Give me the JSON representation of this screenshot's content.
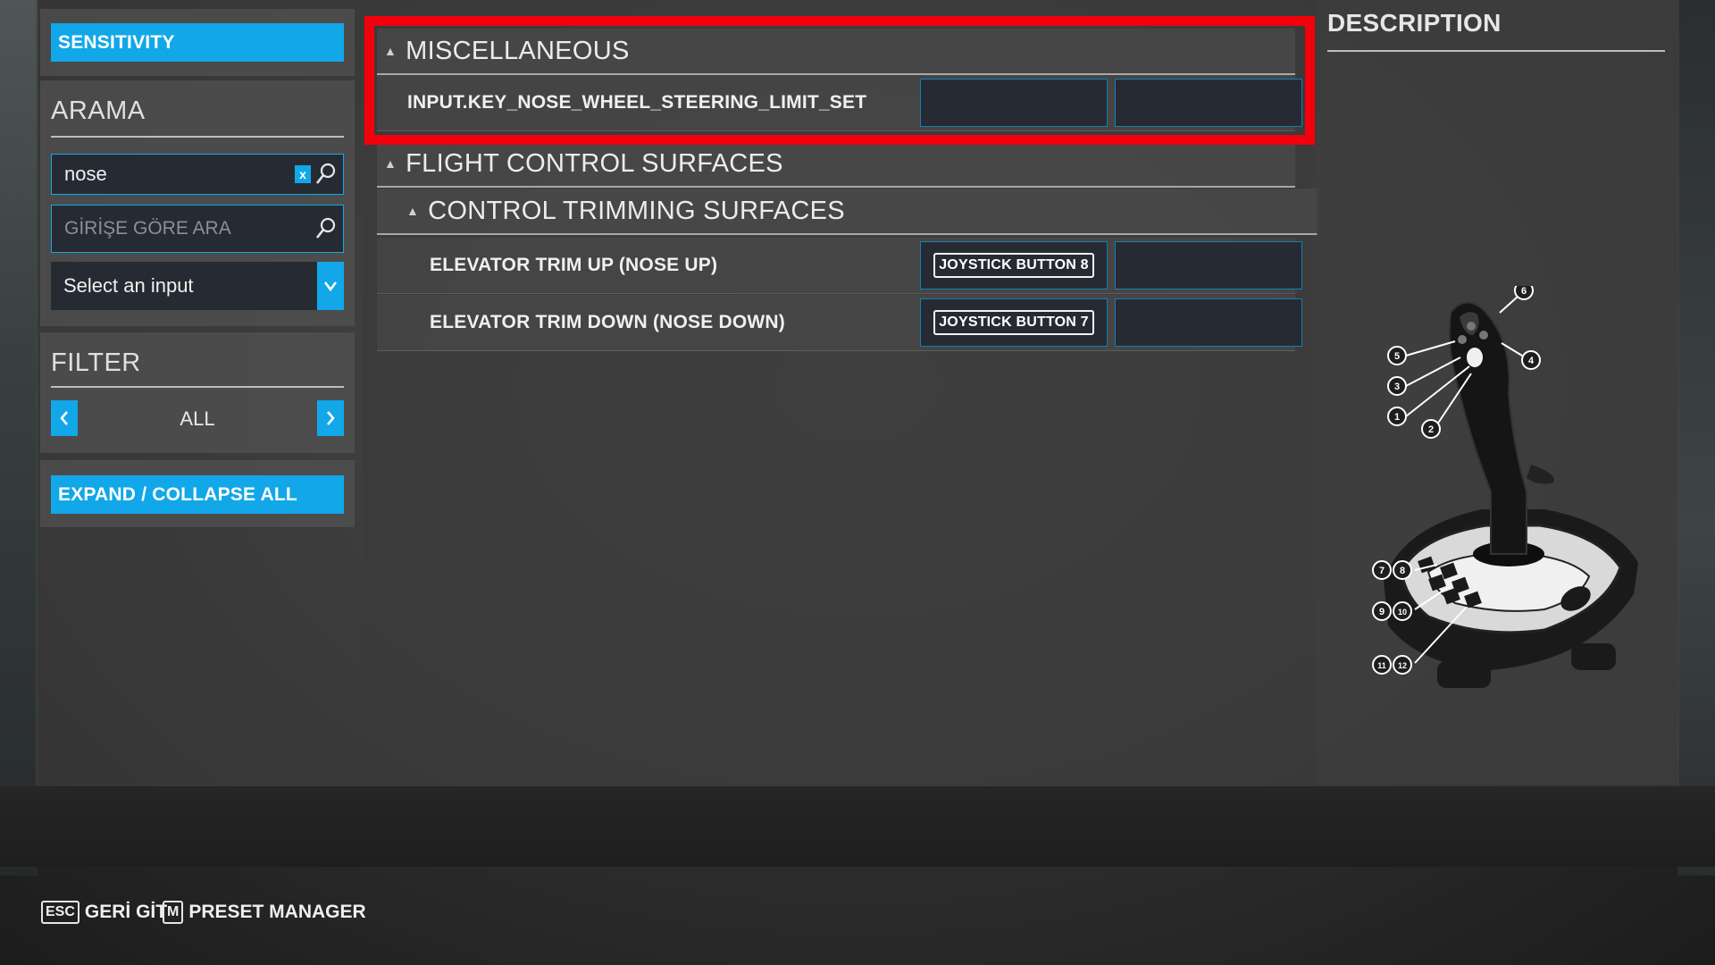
{
  "sidebar": {
    "sensitivity_label": "SENSITIVITY",
    "search_title": "ARAMA",
    "search_value": "nose",
    "clear_label": "x",
    "input_search_placeholder": "GİRİŞE GÖRE ARA",
    "select_input_value": "Select an input",
    "filter_title": "FILTER",
    "filter_value": "ALL",
    "expand_label": "EXPAND / COLLAPSE ALL"
  },
  "sections": {
    "misc": {
      "title": "MISCELLANEOUS",
      "rows": [
        {
          "label": "INPUT.KEY_NOSE_WHEEL_STEERING_LIMIT_SET",
          "binding1": "",
          "binding2": ""
        }
      ]
    },
    "flight_control": {
      "title": "FLIGHT CONTROL SURFACES",
      "subsection": {
        "title": "CONTROL TRIMMING SURFACES",
        "rows": [
          {
            "label": "ELEVATOR TRIM UP (NOSE UP)",
            "binding1": "JOYSTICK BUTTON 8",
            "binding2": ""
          },
          {
            "label": "ELEVATOR TRIM DOWN (NOSE DOWN)",
            "binding1": "JOYSTICK BUTTON 7",
            "binding2": ""
          }
        ]
      }
    }
  },
  "description": {
    "title": "DESCRIPTION",
    "callouts": [
      "6",
      "5",
      "4",
      "3",
      "1",
      "2",
      "7",
      "8",
      "9",
      "10",
      "11",
      "12"
    ]
  },
  "footer": {
    "back_key": "ESC",
    "back_label": "GERİ GİT",
    "preset_key": "M",
    "preset_label": "PRESET MANAGER"
  },
  "colors": {
    "accent": "#12a7e9",
    "highlight": "#f2000b",
    "field_bg": "#262b33"
  }
}
